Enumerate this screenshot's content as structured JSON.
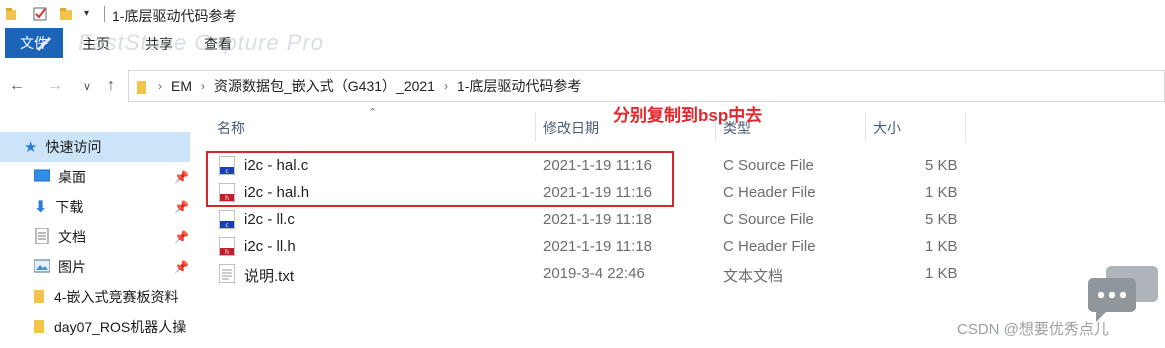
{
  "window": {
    "title": "1-底层驱动代码参考"
  },
  "ribbon": {
    "file_tab": "文件",
    "tabs": [
      "主页",
      "共享",
      "查看"
    ],
    "watermark": "FastStone Capture Pro"
  },
  "nav": {
    "back": "←",
    "forward": "→",
    "recent": "∨",
    "up": "↑"
  },
  "address": {
    "crumbs": [
      "EM",
      "资源数据包_嵌入式（G431）_2021",
      "1-底层驱动代码参考"
    ]
  },
  "sidebar": {
    "items": [
      {
        "label": "快速访问",
        "icon": "star-icon",
        "pinned": false
      },
      {
        "label": "桌面",
        "icon": "desktop-icon",
        "pinned": true
      },
      {
        "label": "下载",
        "icon": "download-icon",
        "pinned": true
      },
      {
        "label": "文档",
        "icon": "document-icon",
        "pinned": true
      },
      {
        "label": "图片",
        "icon": "picture-icon",
        "pinned": true
      },
      {
        "label": "4-嵌入式竞赛板资料",
        "icon": "folder-icon",
        "pinned": false
      },
      {
        "label": "day07_ROS机器人操",
        "icon": "folder-icon",
        "pinned": false
      }
    ]
  },
  "columns": {
    "name": "名称",
    "date": "修改日期",
    "type": "类型",
    "size": "大小"
  },
  "files": [
    {
      "name": "i2c - hal.c",
      "date": "2021-1-19 11:16",
      "type": "C Source File",
      "size": "5 KB",
      "icon": "c-source-file-icon"
    },
    {
      "name": "i2c - hal.h",
      "date": "2021-1-19 11:16",
      "type": "C Header File",
      "size": "1 KB",
      "icon": "c-header-file-icon"
    },
    {
      "name": "i2c - ll.c",
      "date": "2021-1-19 11:18",
      "type": "C Source File",
      "size": "5 KB",
      "icon": "c-source-file-icon"
    },
    {
      "name": "i2c - ll.h",
      "date": "2021-1-19 11:18",
      "type": "C Header File",
      "size": "1 KB",
      "icon": "c-header-file-icon"
    },
    {
      "name": "说明.txt",
      "date": "2019-3-4 22:46",
      "type": "文本文档",
      "size": "1 KB",
      "icon": "text-file-icon"
    }
  ],
  "annotation": {
    "text": "分别复制到bsp中去",
    "color": "#e3262c"
  },
  "footer_watermark": "CSDN @想要优秀点儿",
  "colors": {
    "file_tab": "#1c64b8",
    "highlight": "#d8262a",
    "selected_sidebar": "#cce4f7"
  }
}
